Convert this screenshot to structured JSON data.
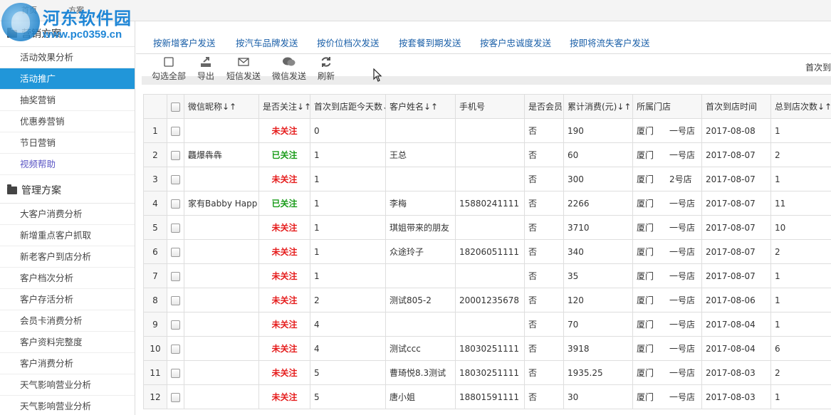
{
  "topbar": {
    "tab_home": "首页",
    "tab_plan": "方案"
  },
  "watermark": {
    "name": "河东软件园",
    "url": "www.pc0359.cn"
  },
  "sidebar": {
    "section1": {
      "title": "营销方案"
    },
    "items1": [
      {
        "label": "活动效果分析",
        "active": false
      },
      {
        "label": "活动推广",
        "active": true
      },
      {
        "label": "抽奖营销",
        "active": false
      },
      {
        "label": "优惠券营销",
        "active": false
      },
      {
        "label": "节日营销",
        "active": false
      },
      {
        "label": "视频帮助",
        "active": false
      }
    ],
    "section2": {
      "title": "管理方案"
    },
    "items2": [
      {
        "label": "大客户消费分析"
      },
      {
        "label": "新增重点客户抓取"
      },
      {
        "label": "新老客户到店分析"
      },
      {
        "label": "客户档次分析"
      },
      {
        "label": "客户存活分析"
      },
      {
        "label": "会员卡消费分析"
      },
      {
        "label": "客户资料完整度"
      },
      {
        "label": "客户消费分析"
      },
      {
        "label": "天气影响营业分析"
      },
      {
        "label": "天气影响营业分析"
      }
    ]
  },
  "tabs": [
    {
      "label": "按新增客户发送",
      "active": true
    },
    {
      "label": "按汽车品牌发送",
      "active": false
    },
    {
      "label": "按价位档次发送",
      "active": false
    },
    {
      "label": "按套餐到期发送",
      "active": false
    },
    {
      "label": "按客户忠诚度发送",
      "active": false
    },
    {
      "label": "按即将流失客户发送",
      "active": false
    }
  ],
  "toolbar": {
    "select_all": "勾选全部",
    "export": "导出",
    "sms": "短信发送",
    "wechat": "微信发送",
    "refresh": "刷新",
    "first_visit_label": "首次到"
  },
  "table": {
    "headers": {
      "nickname": "微信昵称↓↑",
      "followed": "是否关注↓↑",
      "days": "首次到店距今天数↓↑",
      "name": "客户姓名↓↑",
      "phone": "手机号",
      "member": "是否会员",
      "total": "累计消费(元)↓↑",
      "store": "所属门店",
      "first_date": "首次到店时间",
      "visits": "总到店次数↓↑"
    },
    "rows": [
      {
        "idx": "1",
        "nickname": "",
        "followed": "未关注",
        "follow": false,
        "days": "0",
        "name": "",
        "phone": "",
        "member": "否",
        "total": "190",
        "city": "厦门",
        "store": "一号店",
        "date": "2017-08-08",
        "visits": "1"
      },
      {
        "idx": "2",
        "nickname": "龘爆犇犇",
        "followed": "已关注",
        "follow": true,
        "days": "1",
        "name": "王总",
        "phone": "",
        "member": "否",
        "total": "60",
        "city": "厦门",
        "store": "一号店",
        "date": "2017-08-07",
        "visits": "2"
      },
      {
        "idx": "3",
        "nickname": "",
        "followed": "未关注",
        "follow": false,
        "days": "1",
        "name": "",
        "phone": "",
        "member": "否",
        "total": "300",
        "city": "厦门",
        "store": "2号店",
        "date": "2017-08-07",
        "visits": "1"
      },
      {
        "idx": "4",
        "nickname": "家有Babby Happ",
        "followed": "已关注",
        "follow": true,
        "days": "1",
        "name": "李梅",
        "phone": "15880241111",
        "member": "否",
        "total": "2266",
        "city": "厦门",
        "store": "一号店",
        "date": "2017-08-07",
        "visits": "11"
      },
      {
        "idx": "5",
        "nickname": "",
        "followed": "未关注",
        "follow": false,
        "days": "1",
        "name": "琪姐带来的朋友",
        "phone": "",
        "member": "否",
        "total": "3710",
        "city": "厦门",
        "store": "一号店",
        "date": "2017-08-07",
        "visits": "10"
      },
      {
        "idx": "6",
        "nickname": "",
        "followed": "未关注",
        "follow": false,
        "days": "1",
        "name": "众途玲子",
        "phone": "18206051111",
        "member": "否",
        "total": "340",
        "city": "厦门",
        "store": "一号店",
        "date": "2017-08-07",
        "visits": "2"
      },
      {
        "idx": "7",
        "nickname": "",
        "followed": "未关注",
        "follow": false,
        "days": "1",
        "name": "",
        "phone": "",
        "member": "否",
        "total": "35",
        "city": "厦门",
        "store": "一号店",
        "date": "2017-08-07",
        "visits": "1"
      },
      {
        "idx": "8",
        "nickname": "",
        "followed": "未关注",
        "follow": false,
        "days": "2",
        "name": "测试805-2",
        "phone": "20001235678",
        "member": "否",
        "total": "120",
        "city": "厦门",
        "store": "一号店",
        "date": "2017-08-06",
        "visits": "1"
      },
      {
        "idx": "9",
        "nickname": "",
        "followed": "未关注",
        "follow": false,
        "days": "4",
        "name": "",
        "phone": "",
        "member": "否",
        "total": "70",
        "city": "厦门",
        "store": "一号店",
        "date": "2017-08-04",
        "visits": "1"
      },
      {
        "idx": "10",
        "nickname": "",
        "followed": "未关注",
        "follow": false,
        "days": "4",
        "name": "测试ccc",
        "phone": "18030251111",
        "member": "否",
        "total": "3918",
        "city": "厦门",
        "store": "一号店",
        "date": "2017-08-04",
        "visits": "6"
      },
      {
        "idx": "11",
        "nickname": "",
        "followed": "未关注",
        "follow": false,
        "days": "5",
        "name": "曹琦悦8.3测试",
        "phone": "18030251111",
        "member": "否",
        "total": "1935.25",
        "city": "厦门",
        "store": "一号店",
        "date": "2017-08-03",
        "visits": "2"
      },
      {
        "idx": "12",
        "nickname": "",
        "followed": "未关注",
        "follow": false,
        "days": "5",
        "name": "唐小姐",
        "phone": "18801591111",
        "member": "否",
        "total": "30",
        "city": "厦门",
        "store": "一号店",
        "date": "2017-08-03",
        "visits": "1"
      }
    ]
  },
  "colors": {
    "accent": "#2196d9",
    "not_followed": "#e51c1c",
    "followed": "#1a9c1a"
  }
}
